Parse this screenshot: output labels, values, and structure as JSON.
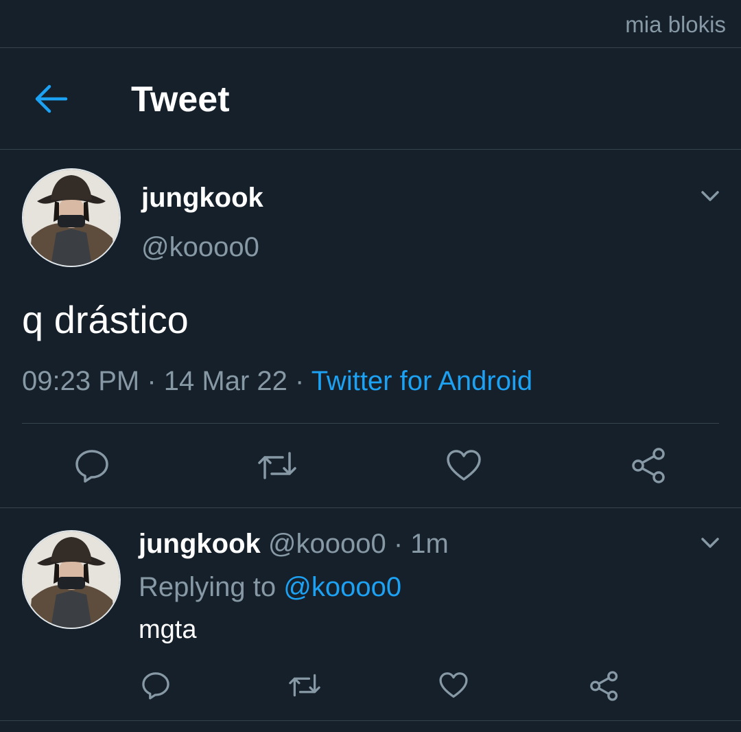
{
  "status_bar": {
    "watermark": "mia blokis"
  },
  "header": {
    "title": "Tweet",
    "back_icon": "arrow-left-icon"
  },
  "main_tweet": {
    "name": "jungkook",
    "handle": "@koooo0",
    "text": "q drástico",
    "time": "09:23 PM",
    "date": "14 Mar 22",
    "separator": " · ",
    "source": "Twitter for Android",
    "menu_icon": "chevron-down-icon",
    "actions": [
      "reply-icon",
      "retweet-icon",
      "like-icon",
      "share-icon"
    ]
  },
  "reply_tweet": {
    "name": "jungkook",
    "handle": "@koooo0",
    "separator": " · ",
    "time_ago": "1m",
    "replying_prefix": "Replying to ",
    "replying_handle": "@koooo0",
    "text": "mgta",
    "menu_icon": "chevron-down-icon",
    "actions": [
      "reply-icon",
      "retweet-icon",
      "like-icon",
      "share-icon"
    ]
  },
  "colors": {
    "background": "#15202b",
    "accent": "#1da1f2",
    "secondary_text": "#8899a6",
    "divider": "#38444d",
    "primary_text": "#ffffff"
  }
}
